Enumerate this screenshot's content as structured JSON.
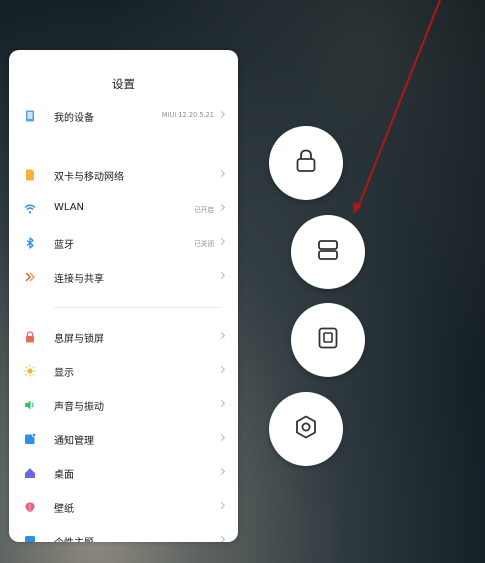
{
  "panel": {
    "title": "设置",
    "items": [
      {
        "label": "我的设备",
        "value": "MIUI 12.20.5.21",
        "icon": "device-icon",
        "color": "#5aa0e6"
      },
      {
        "label": "双卡与移动网络",
        "value": "",
        "icon": "sim-card-icon",
        "color": "#f2b53a"
      },
      {
        "label": "WLAN",
        "value": "已开启",
        "icon": "wifi-icon",
        "color": "#2f8fe8"
      },
      {
        "label": "蓝牙",
        "value": "已关闭",
        "icon": "bluetooth-icon",
        "color": "#2f8fe8"
      },
      {
        "label": "连接与共享",
        "value": "",
        "icon": "connection-share-icon",
        "color": "#e8623a"
      },
      {
        "label": "息屏与锁屏",
        "value": "",
        "icon": "lock-screen-icon",
        "color": "#e86a5a"
      },
      {
        "label": "显示",
        "value": "",
        "icon": "brightness-icon",
        "color": "#f0b82a"
      },
      {
        "label": "声音与振动",
        "value": "",
        "icon": "speaker-icon",
        "color": "#3cc06a"
      },
      {
        "label": "通知管理",
        "value": "",
        "icon": "notification-icon",
        "color": "#2f8fe8"
      },
      {
        "label": "桌面",
        "value": "",
        "icon": "home-icon",
        "color": "#6b67e0"
      },
      {
        "label": "壁纸",
        "value": "",
        "icon": "wallpaper-icon",
        "color": "#e8607e"
      },
      {
        "label": "个性主题",
        "value": "",
        "icon": "theme-icon",
        "color": "#2f8fe8"
      }
    ]
  },
  "quick_buttons": [
    {
      "name": "lock-button",
      "icon": "lock-icon"
    },
    {
      "name": "split-screen-button",
      "icon": "split-screen-icon"
    },
    {
      "name": "small-window-button",
      "icon": "small-window-icon"
    },
    {
      "name": "settings-button",
      "icon": "hexagon-settings-icon"
    }
  ],
  "annotation": {
    "color": "#b0161c",
    "icon": "red-arrow-icon"
  }
}
